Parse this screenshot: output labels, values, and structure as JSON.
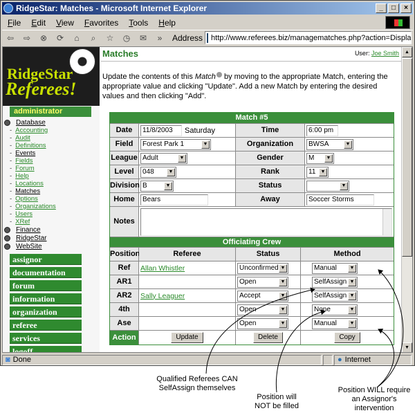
{
  "window": {
    "title": "RidgeStar: Matches - Microsoft Internet Explorer"
  },
  "menu": [
    "File",
    "Edit",
    "View",
    "Favorites",
    "Tools",
    "Help"
  ],
  "address": {
    "label": "Address",
    "url": "http://www.referees.biz/managematches.php?action=Display&key="
  },
  "logo": {
    "line1": "RidgeStar",
    "line2": "Referees!"
  },
  "sidebar": {
    "admin_header": "administrator",
    "sections": [
      "Database",
      "Finance",
      "RidgeStar",
      "WebSite"
    ],
    "database_items": [
      "Accounting",
      "Audit",
      "Definitions",
      "Events",
      "Fields",
      "Forum",
      "Help",
      "Locations",
      "Matches",
      "Options",
      "Organizations",
      "Users",
      "XRef"
    ],
    "big_nav": [
      "assignor",
      "documentation",
      "forum",
      "information",
      "organization",
      "referee",
      "services",
      "logoff"
    ]
  },
  "page": {
    "title": "Matches",
    "user_label": "User:",
    "user_name": "Joe Smith",
    "intro_1": "Update the contents of this ",
    "intro_match": "Match",
    "intro_2": " by moving to the appropriate Match, entering the appropriate value and clicking \"Update\". Add a new Match by entering the desired values and then clicking \"Add\"."
  },
  "match": {
    "header": "Match #5",
    "date_label": "Date",
    "date": "11/8/2003",
    "day": "Saturday",
    "time_label": "Time",
    "time": "6:00 pm",
    "field_label": "Field",
    "field": "Forest Park 1",
    "org_label": "Organization",
    "org": "BWSA",
    "league_label": "League",
    "league": "Adult",
    "gender_label": "Gender",
    "gender": "M",
    "level_label": "Level",
    "level": "048",
    "rank_label": "Rank",
    "rank": "11",
    "division_label": "Division",
    "division": "B",
    "status_label": "Status",
    "status": "",
    "home_label": "Home",
    "home": "Bears",
    "away_label": "Away",
    "away": "Soccer Storms",
    "notes_label": "Notes"
  },
  "crew": {
    "header": "Officiating Crew",
    "columns": [
      "Position",
      "Referee",
      "Status",
      "Method"
    ],
    "rows": [
      {
        "position": "Ref",
        "referee": "Allan Whistler",
        "status": "Unconfirmed",
        "method": "Manual"
      },
      {
        "position": "AR1",
        "referee": "",
        "status": "Open",
        "method": "SelfAssign"
      },
      {
        "position": "AR2",
        "referee": "Sally Leaguer",
        "status": "Accept",
        "method": "SelfAssign"
      },
      {
        "position": "4th",
        "referee": "",
        "status": "Open",
        "method": "None"
      },
      {
        "position": "Ase",
        "referee": "",
        "status": "Open",
        "method": "Manual"
      }
    ],
    "action_label": "Action",
    "update": "Update",
    "delete": "Delete",
    "copy": "Copy"
  },
  "statusbar": {
    "text": "Done",
    "zone": "Internet"
  },
  "annotations": {
    "a1": "Qualified Referees CAN SelfAssign themselves",
    "a2": "Position will NOT be filled",
    "a3": "Position WILL require an Assignor's intervention"
  }
}
